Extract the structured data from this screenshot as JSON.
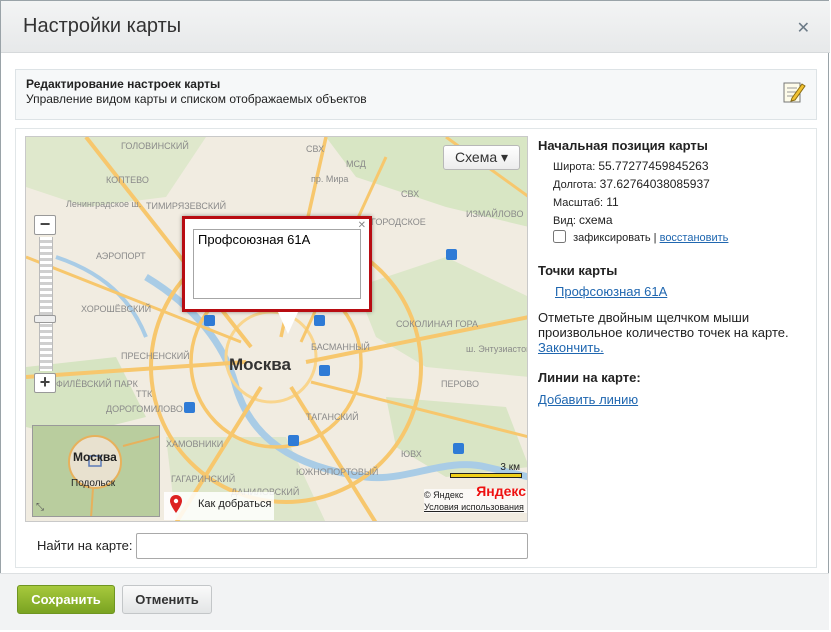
{
  "dialog": {
    "title": "Настройки карты",
    "close_icon": "close-icon"
  },
  "description": {
    "title": "Редактирование настроек карты",
    "subtitle": "Управление видом карты и списком отображаемых объектов",
    "icon": "edit-note-icon"
  },
  "map": {
    "type_button": "Схема ▾",
    "zoom_in": "+",
    "zoom_out": "−",
    "city_label": "Москва",
    "balloon_text": "Профсоюзная 61А",
    "minimap_city": "Москва",
    "minimap_town": "Подольск",
    "route_label": "Как добраться",
    "scale_label": "3 км",
    "copyright": "© Яндекс",
    "terms": "Условия использования",
    "brand": "Яндекс",
    "district_labels": [
      "ГОЛОВИНСКИЙ",
      "КОПТЕВО",
      "ТИМИРЯЗЕВСКИЙ",
      "АЭРОПОРТ",
      "ХОРОШЁВСКИЙ",
      "ПРЕСНЕНСКИЙ",
      "ФИЛЁВСКИЙ ПАРК",
      "ХАМОВНИКИ",
      "ГАГАРИНСКИЙ",
      "ДАНИЛОВСКИЙ",
      "БАСМАННЫЙ",
      "ТАГАНСКИЙ",
      "СОКОЛИНАЯ ГОРА",
      "ПЕРОВО",
      "ЮЖНОПОРТОВЫЙ",
      "ДОРОГОМИЛОВО",
      "ГОРОДСКОЕ",
      "ИЗМАЙЛОВО"
    ],
    "road_labels": [
      "СВХ",
      "МСД",
      "ТТК",
      "ЮВХ",
      "СВХ",
      "ш. Энтузиастов",
      "Ленинградское ш.",
      "пр. Мира"
    ]
  },
  "search": {
    "label": "Найти на карте:",
    "value": "",
    "placeholder": ""
  },
  "side": {
    "position_title": "Начальная позиция карты",
    "lat_label": "Широта:",
    "lat_value": "55.77277459845263",
    "lon_label": "Долгота:",
    "lon_value": "37.62764038085937",
    "zoom_label": "Масштаб:",
    "zoom_value": "11",
    "view_label": "Вид:",
    "view_value": "схема",
    "fix_label": "зафиксировать",
    "separator": "|",
    "restore_link": "восстановить",
    "points_title": "Точки карты",
    "point_link": "Профсоюзная 61А",
    "points_hint": "Отметьте двойным щелчком мыши произвольное количество точек на карте.",
    "finish_link": "Закончить.",
    "lines_title": "Линии на карте:",
    "add_line_link": "Добавить линию"
  },
  "footer": {
    "save": "Сохранить",
    "cancel": "Отменить"
  }
}
